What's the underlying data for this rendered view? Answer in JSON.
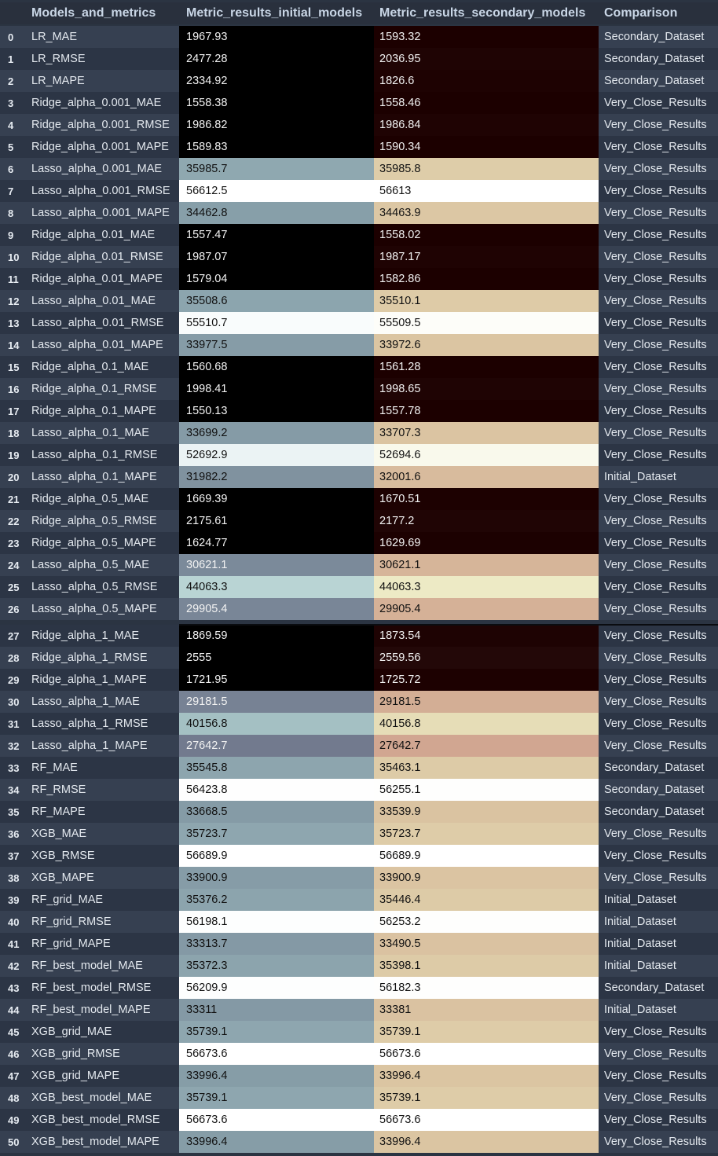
{
  "table": {
    "headers": [
      "Models_and_metrics",
      "Metric_results_initial_models",
      "Metric_results_secondary_models",
      "Comparison"
    ],
    "rows": [
      [
        "0",
        "LR_MAE",
        "1967.93",
        "1593.32",
        "Secondary_Dataset"
      ],
      [
        "1",
        "LR_RMSE",
        "2477.28",
        "2036.95",
        "Secondary_Dataset"
      ],
      [
        "2",
        "LR_MAPE",
        "2334.92",
        "1826.6",
        "Secondary_Dataset"
      ],
      [
        "3",
        "Ridge_alpha_0.001_MAE",
        "1558.38",
        "1558.46",
        "Very_Close_Results"
      ],
      [
        "4",
        "Ridge_alpha_0.001_RMSE",
        "1986.82",
        "1986.84",
        "Very_Close_Results"
      ],
      [
        "5",
        "Ridge_alpha_0.001_MAPE",
        "1589.83",
        "1590.34",
        "Very_Close_Results"
      ],
      [
        "6",
        "Lasso_alpha_0.001_MAE",
        "35985.7",
        "35985.8",
        "Very_Close_Results"
      ],
      [
        "7",
        "Lasso_alpha_0.001_RMSE",
        "56612.5",
        "56613",
        "Very_Close_Results"
      ],
      [
        "8",
        "Lasso_alpha_0.001_MAPE",
        "34462.8",
        "34463.9",
        "Very_Close_Results"
      ],
      [
        "9",
        "Ridge_alpha_0.01_MAE",
        "1557.47",
        "1558.02",
        "Very_Close_Results"
      ],
      [
        "10",
        "Ridge_alpha_0.01_RMSE",
        "1987.07",
        "1987.17",
        "Very_Close_Results"
      ],
      [
        "11",
        "Ridge_alpha_0.01_MAPE",
        "1579.04",
        "1582.86",
        "Very_Close_Results"
      ],
      [
        "12",
        "Lasso_alpha_0.01_MAE",
        "35508.6",
        "35510.1",
        "Very_Close_Results"
      ],
      [
        "13",
        "Lasso_alpha_0.01_RMSE",
        "55510.7",
        "55509.5",
        "Very_Close_Results"
      ],
      [
        "14",
        "Lasso_alpha_0.01_MAPE",
        "33977.5",
        "33972.6",
        "Very_Close_Results"
      ],
      [
        "15",
        "Ridge_alpha_0.1_MAE",
        "1560.68",
        "1561.28",
        "Very_Close_Results"
      ],
      [
        "16",
        "Ridge_alpha_0.1_RMSE",
        "1998.41",
        "1998.65",
        "Very_Close_Results"
      ],
      [
        "17",
        "Ridge_alpha_0.1_MAPE",
        "1550.13",
        "1557.78",
        "Very_Close_Results"
      ],
      [
        "18",
        "Lasso_alpha_0.1_MAE",
        "33699.2",
        "33707.3",
        "Very_Close_Results"
      ],
      [
        "19",
        "Lasso_alpha_0.1_RMSE",
        "52692.9",
        "52694.6",
        "Very_Close_Results"
      ],
      [
        "20",
        "Lasso_alpha_0.1_MAPE",
        "31982.2",
        "32001.6",
        "Initial_Dataset"
      ],
      [
        "21",
        "Ridge_alpha_0.5_MAE",
        "1669.39",
        "1670.51",
        "Very_Close_Results"
      ],
      [
        "22",
        "Ridge_alpha_0.5_RMSE",
        "2175.61",
        "2177.2",
        "Very_Close_Results"
      ],
      [
        "23",
        "Ridge_alpha_0.5_MAPE",
        "1624.77",
        "1629.69",
        "Very_Close_Results"
      ],
      [
        "24",
        "Lasso_alpha_0.5_MAE",
        "30621.1",
        "30621.1",
        "Very_Close_Results"
      ],
      [
        "25",
        "Lasso_alpha_0.5_RMSE",
        "44063.3",
        "44063.3",
        "Very_Close_Results"
      ],
      [
        "26",
        "Lasso_alpha_0.5_MAPE",
        "29905.4",
        "29905.4",
        "Very_Close_Results"
      ],
      [
        "27",
        "Ridge_alpha_1_MAE",
        "1869.59",
        "1873.54",
        "Very_Close_Results"
      ],
      [
        "28",
        "Ridge_alpha_1_RMSE",
        "2555",
        "2559.56",
        "Very_Close_Results"
      ],
      [
        "29",
        "Ridge_alpha_1_MAPE",
        "1721.95",
        "1725.72",
        "Very_Close_Results"
      ],
      [
        "30",
        "Lasso_alpha_1_MAE",
        "29181.5",
        "29181.5",
        "Very_Close_Results"
      ],
      [
        "31",
        "Lasso_alpha_1_RMSE",
        "40156.8",
        "40156.8",
        "Very_Close_Results"
      ],
      [
        "32",
        "Lasso_alpha_1_MAPE",
        "27642.7",
        "27642.7",
        "Very_Close_Results"
      ],
      [
        "33",
        "RF_MAE",
        "35545.8",
        "35463.1",
        "Secondary_Dataset"
      ],
      [
        "34",
        "RF_RMSE",
        "56423.8",
        "56255.1",
        "Secondary_Dataset"
      ],
      [
        "35",
        "RF_MAPE",
        "33668.5",
        "33539.9",
        "Secondary_Dataset"
      ],
      [
        "36",
        "XGB_MAE",
        "35723.7",
        "35723.7",
        "Very_Close_Results"
      ],
      [
        "37",
        "XGB_RMSE",
        "56689.9",
        "56689.9",
        "Very_Close_Results"
      ],
      [
        "38",
        "XGB_MAPE",
        "33900.9",
        "33900.9",
        "Very_Close_Results"
      ],
      [
        "39",
        "RF_grid_MAE",
        "35376.2",
        "35446.4",
        "Initial_Dataset"
      ],
      [
        "40",
        "RF_grid_RMSE",
        "56198.1",
        "56253.2",
        "Initial_Dataset"
      ],
      [
        "41",
        "RF_grid_MAPE",
        "33313.7",
        "33490.5",
        "Initial_Dataset"
      ],
      [
        "42",
        "RF_best_model_MAE",
        "35372.3",
        "35398.1",
        "Initial_Dataset"
      ],
      [
        "43",
        "RF_best_model_RMSE",
        "56209.9",
        "56182.3",
        "Secondary_Dataset"
      ],
      [
        "44",
        "RF_best_model_MAPE",
        "33311",
        "33381",
        "Initial_Dataset"
      ],
      [
        "45",
        "XGB_grid_MAE",
        "35739.1",
        "35739.1",
        "Very_Close_Results"
      ],
      [
        "46",
        "XGB_grid_RMSE",
        "56673.6",
        "56673.6",
        "Very_Close_Results"
      ],
      [
        "47",
        "XGB_grid_MAPE",
        "33996.4",
        "33996.4",
        "Very_Close_Results"
      ],
      [
        "48",
        "XGB_best_model_MAE",
        "35739.1",
        "35739.1",
        "Very_Close_Results"
      ],
      [
        "49",
        "XGB_best_model_RMSE",
        "56673.6",
        "56673.6",
        "Very_Close_Results"
      ],
      [
        "50",
        "XGB_best_model_MAPE",
        "33996.4",
        "33996.4",
        "Very_Close_Results"
      ]
    ]
  },
  "colors": {
    "page_background": "#2b3442",
    "header_background": "#29303d",
    "header_text": "#c9d6e6",
    "row_even": "#364051",
    "row_odd": "#2c3545",
    "initial_gradient": [
      [
        0.0,
        "#000000"
      ],
      [
        0.05,
        "#000000"
      ],
      [
        0.45,
        "#6e7389"
      ],
      [
        0.6,
        "#88a0aa"
      ],
      [
        0.75,
        "#b2d0d0"
      ],
      [
        0.95,
        "#f2f7f9"
      ],
      [
        1.0,
        "#ffffff"
      ]
    ],
    "secondary_gradient": [
      [
        0.0,
        "#1c0000"
      ],
      [
        0.05,
        "#2e1616"
      ],
      [
        0.45,
        "#cfa08e"
      ],
      [
        0.6,
        "#dcc8a4"
      ],
      [
        0.75,
        "#ebe8c0"
      ],
      [
        0.95,
        "#fbfbf2"
      ],
      [
        1.0,
        "#ffffff"
      ]
    ]
  }
}
